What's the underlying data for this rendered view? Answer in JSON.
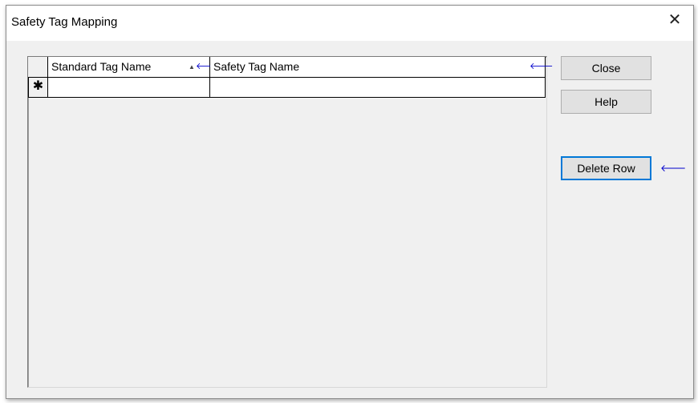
{
  "window": {
    "title": "Safety Tag Mapping",
    "close_glyph": "✕"
  },
  "grid": {
    "columns": [
      {
        "label": "Standard Tag Name",
        "sort_indicator": "▲",
        "arrow": "🡐"
      },
      {
        "label": "Safety Tag Name",
        "arrow": "🡐"
      }
    ],
    "new_row_marker": "✱",
    "rows": [
      {
        "standard_tag": "",
        "safety_tag": ""
      }
    ]
  },
  "buttons": {
    "close_label": "Close",
    "help_label": "Help",
    "delete_row_label": "Delete Row",
    "delete_row_arrow": "🡐"
  },
  "colors": {
    "arrow": "#0000cc",
    "dialog_bg": "#f0f0f0",
    "default_button_border": "#0078d7"
  }
}
